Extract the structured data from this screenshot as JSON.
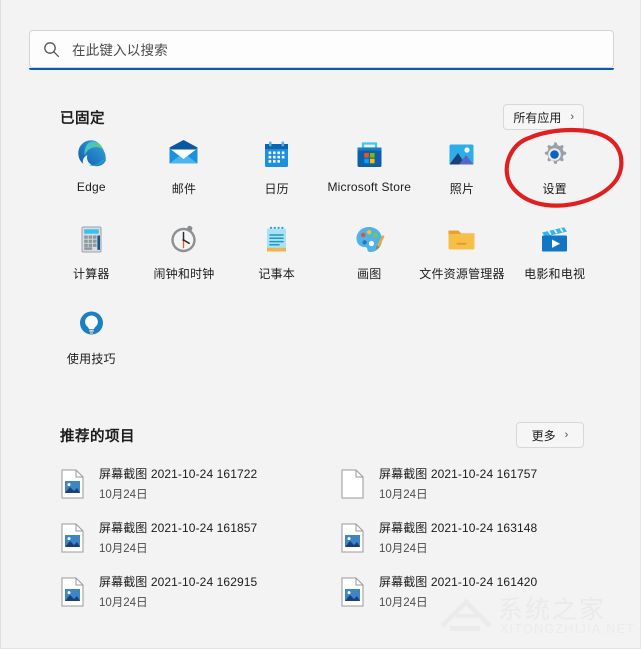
{
  "search": {
    "placeholder": "在此键入以搜索",
    "icon": "search-icon"
  },
  "pinned": {
    "title": "已固定",
    "all_apps_label": "所有应用",
    "chevron": "›",
    "apps": [
      {
        "label": "Edge",
        "icon": "edge-icon"
      },
      {
        "label": "邮件",
        "icon": "mail-icon"
      },
      {
        "label": "日历",
        "icon": "calendar-icon"
      },
      {
        "label": "Microsoft Store",
        "icon": "microsoft-store-icon"
      },
      {
        "label": "照片",
        "icon": "photos-icon"
      },
      {
        "label": "设置",
        "icon": "settings-gear-icon"
      },
      {
        "label": "计算器",
        "icon": "calculator-icon"
      },
      {
        "label": "闹钟和时钟",
        "icon": "alarms-clock-icon"
      },
      {
        "label": "记事本",
        "icon": "notepad-icon"
      },
      {
        "label": "画图",
        "icon": "paint-palette-icon"
      },
      {
        "label": "文件资源管理器",
        "icon": "file-explorer-icon"
      },
      {
        "label": "电影和电视",
        "icon": "movies-tv-icon"
      },
      {
        "label": "使用技巧",
        "icon": "tips-lightbulb-icon"
      }
    ]
  },
  "recommended": {
    "title": "推荐的项目",
    "more_label": "更多",
    "chevron": "›",
    "items": [
      {
        "name": "屏幕截图 2021-10-24 161722",
        "date": "10月24日",
        "icon": "image-file-icon"
      },
      {
        "name": "屏幕截图 2021-10-24 161757",
        "date": "10月24日",
        "icon": "blank-file-icon"
      },
      {
        "name": "屏幕截图 2021-10-24 161857",
        "date": "10月24日",
        "icon": "image-file-icon"
      },
      {
        "name": "屏幕截图 2021-10-24 163148",
        "date": "10月24日",
        "icon": "image-file-icon"
      },
      {
        "name": "屏幕截图 2021-10-24 162915",
        "date": "10月24日",
        "icon": "image-file-icon"
      },
      {
        "name": "屏幕截图 2021-10-24 161420",
        "date": "10月24日",
        "icon": "image-file-icon"
      }
    ]
  },
  "annotation": {
    "shape": "hand-drawn-circle",
    "color": "#e02020",
    "target": "设置"
  },
  "watermark": {
    "text_cn": "系统之家",
    "text_en": "XITONGZHIJIA.NET"
  },
  "colors": {
    "background": "#f3f3f3",
    "accent": "#0a5bb5",
    "annotation_red": "#e02020"
  }
}
